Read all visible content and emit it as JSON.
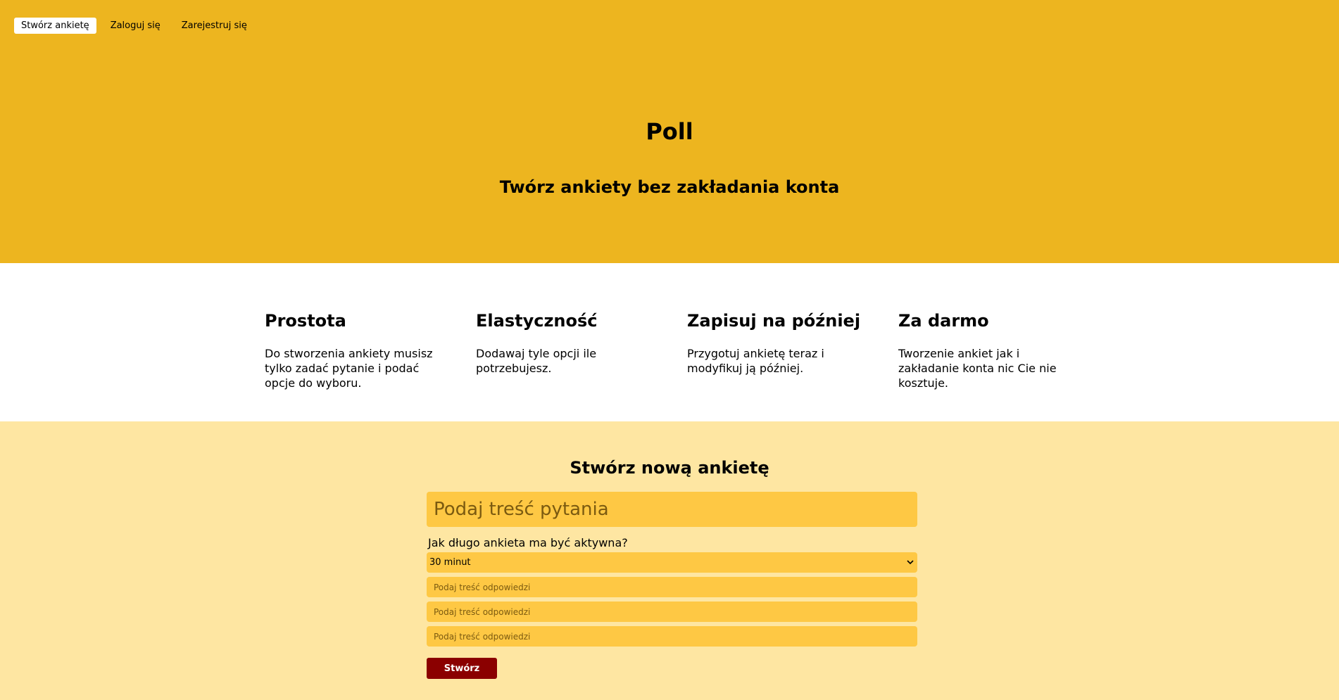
{
  "nav": {
    "items": [
      {
        "label": "Stwórz ankietę",
        "active": true
      },
      {
        "label": "Zaloguj się",
        "active": false
      },
      {
        "label": "Zarejestruj się",
        "active": false
      }
    ]
  },
  "hero": {
    "title": "Poll",
    "subtitle": "Twórz ankiety bez zakładania konta"
  },
  "features": [
    {
      "title": "Prostota",
      "text": "Do stworzenia ankiety musisz tylko zadać pytanie i podać opcje do wyboru."
    },
    {
      "title": "Elastyczność",
      "text": "Dodawaj tyle opcji ile potrzebujesz."
    },
    {
      "title": "Zapisuj na później",
      "text": "Przygotuj ankietę teraz i modyfikuj ją później."
    },
    {
      "title": "Za darmo",
      "text": "Tworzenie ankiet jak i zakładanie konta nic Cie nie kosztuje."
    }
  ],
  "form": {
    "title": "Stwórz nową ankietę",
    "question_placeholder": "Podaj treść pytania",
    "duration_label": "Jak długo ankieta ma być aktywna?",
    "duration_value": "30 minut",
    "answers": [
      {
        "placeholder": "Podaj treść odpowiedzi"
      },
      {
        "placeholder": "Podaj treść odpowiedzi"
      },
      {
        "placeholder": "Podaj treść odpowiedzi"
      }
    ],
    "submit_label": "Stwórz"
  },
  "colors": {
    "hero_bg": "#edb51f",
    "form_bg": "#fee6a2",
    "input_bg": "#fec844",
    "button_bg": "#8b0000"
  }
}
